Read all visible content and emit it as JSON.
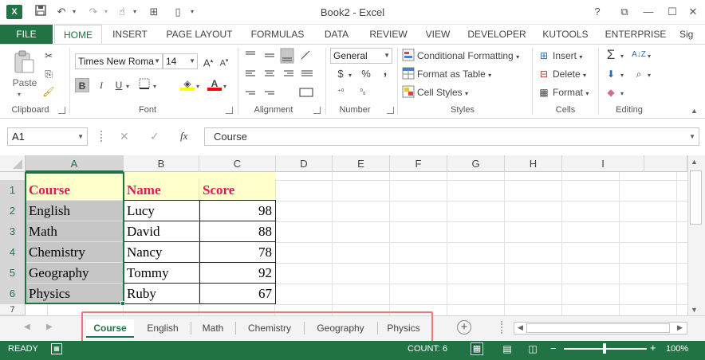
{
  "window": {
    "title": "Book2 - Excel",
    "help": "?",
    "app_icon_label": "X"
  },
  "ribbon_tabs": [
    "FILE",
    "HOME",
    "INSERT",
    "PAGE LAYOUT",
    "FORMULAS",
    "DATA",
    "REVIEW",
    "VIEW",
    "DEVELOPER",
    "KUTOOLS",
    "ENTERPRISE",
    "Sig"
  ],
  "ribbon": {
    "clipboard": {
      "paste_label": "Paste",
      "group_label": "Clipboard"
    },
    "font": {
      "family": "Times New Roma",
      "size": "14",
      "bold": "B",
      "italic": "I",
      "underline": "U",
      "group_label": "Font"
    },
    "alignment": {
      "group_label": "Alignment"
    },
    "number": {
      "format": "General",
      "currency": "$",
      "percent": "%",
      "comma": ",",
      "group_label": "Number"
    },
    "styles": {
      "conditional": "Conditional Formatting",
      "format_table": "Format as Table",
      "cell_styles": "Cell Styles",
      "group_label": "Styles"
    },
    "cells": {
      "insert": "Insert",
      "delete": "Delete",
      "format": "Format",
      "group_label": "Cells"
    },
    "editing": {
      "group_label": "Editing"
    }
  },
  "formula_bar": {
    "name_box": "A1",
    "fx": "fx",
    "formula": "Course"
  },
  "columns": [
    "A",
    "B",
    "C",
    "D",
    "E",
    "F",
    "G",
    "H",
    "I"
  ],
  "rows": [
    "1",
    "2",
    "3",
    "4",
    "5",
    "6",
    "7"
  ],
  "table": {
    "headers": [
      "Course",
      "Name",
      "Score"
    ],
    "rows": [
      [
        "English",
        "Lucy",
        "98"
      ],
      [
        "Math",
        "David",
        "88"
      ],
      [
        "Chemistry",
        "Nancy",
        "78"
      ],
      [
        "Geography",
        "Tommy",
        "92"
      ],
      [
        "Physics",
        "Ruby",
        "67"
      ]
    ]
  },
  "sheets": [
    "Course",
    "English",
    "Math",
    "Chemistry",
    "Geography",
    "Physics"
  ],
  "status": {
    "mode": "READY",
    "count": "COUNT: 6",
    "zoom": "100%",
    "zoom_level_pct": 100
  },
  "colors": {
    "accent": "#217346",
    "header_fill": "#ffffcc",
    "header_text": "#e2185b",
    "selection": "#c6c6c6",
    "highlight": "#e8787b"
  }
}
